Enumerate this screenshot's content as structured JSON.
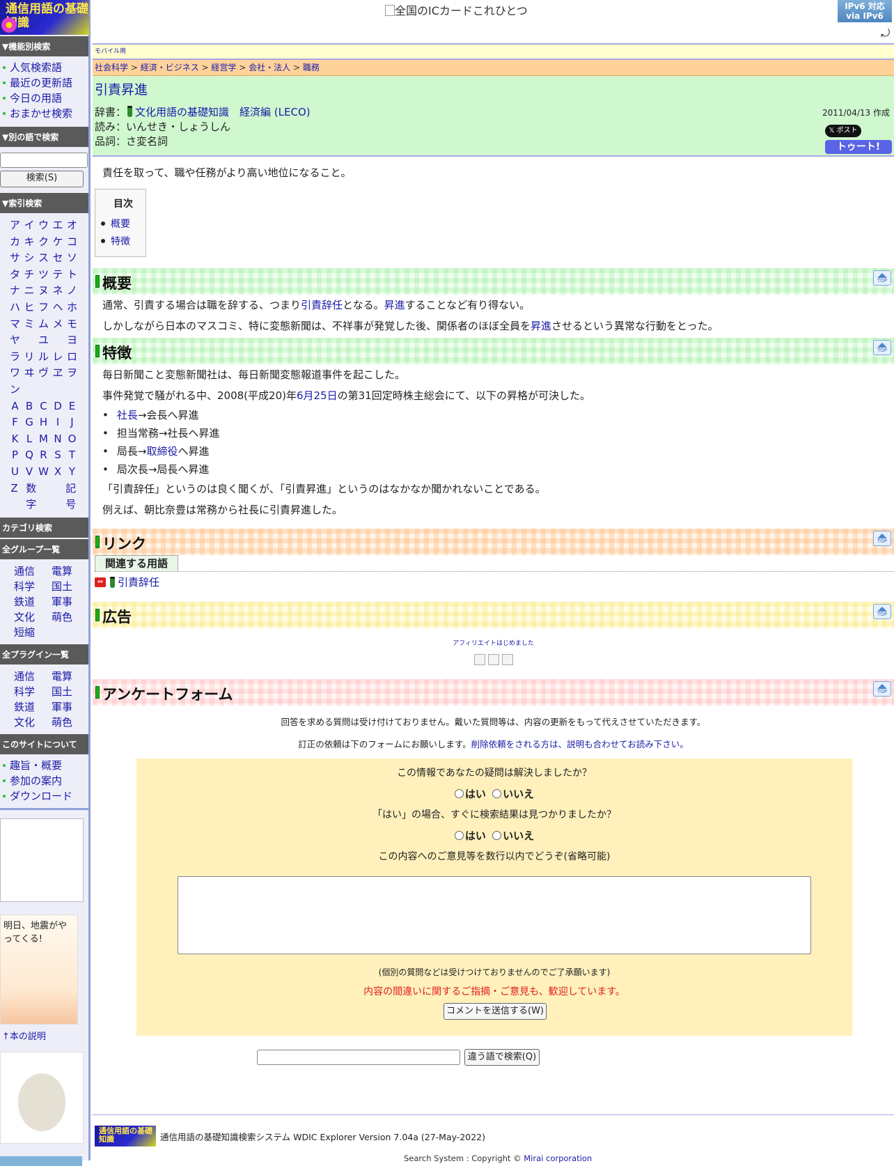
{
  "sidebar": {
    "logo": "通信用語の基礎知識",
    "function_search_header": "▼機能別検索",
    "function_items": [
      "人気検索語",
      "最近の更新語",
      "今日の用語",
      "おまかせ検索"
    ],
    "other_word_header": "▼別の語で検索",
    "search_button": "検索(S)",
    "index_header": "▼索引検索",
    "kana_rows": [
      [
        "ア",
        "イ",
        "ウ",
        "エ",
        "オ"
      ],
      [
        "カ",
        "キ",
        "ク",
        "ケ",
        "コ"
      ],
      [
        "サ",
        "シ",
        "ス",
        "セ",
        "ソ"
      ],
      [
        "タ",
        "チ",
        "ツ",
        "テ",
        "ト"
      ],
      [
        "ナ",
        "ニ",
        "ヌ",
        "ネ",
        "ノ"
      ],
      [
        "ハ",
        "ヒ",
        "フ",
        "ヘ",
        "ホ"
      ],
      [
        "マ",
        "ミ",
        "ム",
        "メ",
        "モ"
      ],
      [
        "ヤ",
        "",
        "ユ",
        "",
        "ヨ"
      ],
      [
        "ラ",
        "リ",
        "ル",
        "レ",
        "ロ"
      ],
      [
        "ワ",
        "ヰ",
        "ヴ",
        "ヱ",
        "ヲ"
      ],
      [
        "ン"
      ],
      [
        "A",
        "B",
        "C",
        "D",
        "E"
      ],
      [
        "F",
        "G",
        "H",
        "I",
        "J"
      ],
      [
        "K",
        "L",
        "M",
        "N",
        "O"
      ],
      [
        "P",
        "Q",
        "R",
        "S",
        "T"
      ],
      [
        "U",
        "V",
        "W",
        "X",
        "Y"
      ],
      [
        "Z",
        "数字",
        "",
        "記号"
      ]
    ],
    "category_header": "カテゴリ検索",
    "group_header": "全グループ一覧",
    "groups": [
      "通信",
      "電算",
      "科学",
      "国土",
      "鉄道",
      "軍事",
      "文化",
      "萌色",
      "短縮"
    ],
    "plugin_header": "全プラグイン一覧",
    "plugins": [
      "通信",
      "電算",
      "科学",
      "国土",
      "鉄道",
      "軍事",
      "文化",
      "萌色"
    ],
    "about_header": "このサイトについて",
    "about_items": [
      "趣旨・概要",
      "参加の案内",
      "ダウンロード"
    ],
    "book_title": "明日、地震がやってくる!",
    "book_note": "↑本の説明"
  },
  "top": {
    "ic_card_alt": "全国のICカードこれひとつ",
    "ipv6_line1": "IPv6 対応",
    "ipv6_line2": "via IPv6"
  },
  "main": {
    "mobile_label": "モバイル用",
    "breadcrumb": [
      "社会科学",
      "経済・ビジネス",
      "経営学",
      "会社・法人",
      "職務"
    ],
    "title": "引責昇進",
    "dict_label": "辞書：",
    "dict_name": "文化用語の基礎知識　経済編 (LECO)",
    "reading": "読み：いんせき・しょうしん",
    "pos": "品詞：さ変名詞",
    "date": "2011/04/13 作成",
    "x_button": "𝕏 ポスト",
    "toot_button": "トゥート!",
    "summary": "責任を取って、職や任務がより高い地位になること。",
    "toc_title": "目次",
    "toc_items": [
      "概要",
      "特徴"
    ],
    "sec1_title": "概要",
    "sec1_p1": [
      "通常、引責する場合は職を辞する、つまり",
      "引責辞任",
      "となる。",
      "昇進",
      "することなど有り得ない。"
    ],
    "sec1_p2": [
      "しかしながら日本のマスコミ、特に変態新聞は、不祥事が発覚した後、関係者のほぼ全員を",
      "昇進",
      "させるという異常な行動をとった。"
    ],
    "sec2_title": "特徴",
    "sec2_p1": "毎日新聞こと変態新聞社は、毎日新聞変態報道事件を起こした。",
    "sec2_p2": [
      "事件発覚で騒がれる中、2008(平成20)年",
      "6月25日",
      "の第31回定時株主総会にて、以下の昇格が可決した。"
    ],
    "list": [
      [
        "社長",
        "→会長へ昇進"
      ],
      [
        "",
        "担当常務→社長へ昇進"
      ],
      [
        "局長→",
        "取締役",
        "へ昇進"
      ],
      [
        "",
        "局次長→局長へ昇進"
      ]
    ],
    "sec2_p3": "「引責辞任」というのは良く聞くが、「引責昇進」というのはなかなか聞かれないことである。",
    "sec2_p4": "例えば、朝比奈豊は常務から社長に引責昇進した。",
    "link_title": "リンク",
    "related_tab": "関連する用語",
    "related_item": "引責辞任",
    "ad_title": "広告",
    "ad_text": "アフィリエイトはじめました",
    "survey_title": "アンケートフォーム",
    "survey_note1": "回答を求める質問は受け付けておりません。戴いた質問等は、内容の更新をもって代えさせていただきます。",
    "survey_note2a": "訂正の依頼は下のフォームにお願いします。",
    "survey_note2b": "削除依頼をされる方は、説明も合わせてお読み下さい。",
    "q1": "この情報であなたの疑問は解決しましたか？",
    "q2": "「はい」の場合、すぐに検索結果は見つかりましたか？",
    "yes": "はい",
    "no": "いいえ",
    "q3": "この内容へのご意見等を数行以内でどうぞ(省略可能)",
    "note_personal": "(個別の質問などは受けつけておりませんのでご了承願います)",
    "note_welcome": "内容の間違いに関するご指摘・ご意見も、歓迎しています。",
    "send_button": "コメントを送信する(W)",
    "other_search_button": "違う語で検索(Q)",
    "footer_text": "通信用語の基礎知識検索システム WDIC Explorer Version 7.04a (27-May-2022)",
    "copyright_prefix": "Search System : Copyright ©",
    "copyright_link": "Mirai corporation"
  }
}
